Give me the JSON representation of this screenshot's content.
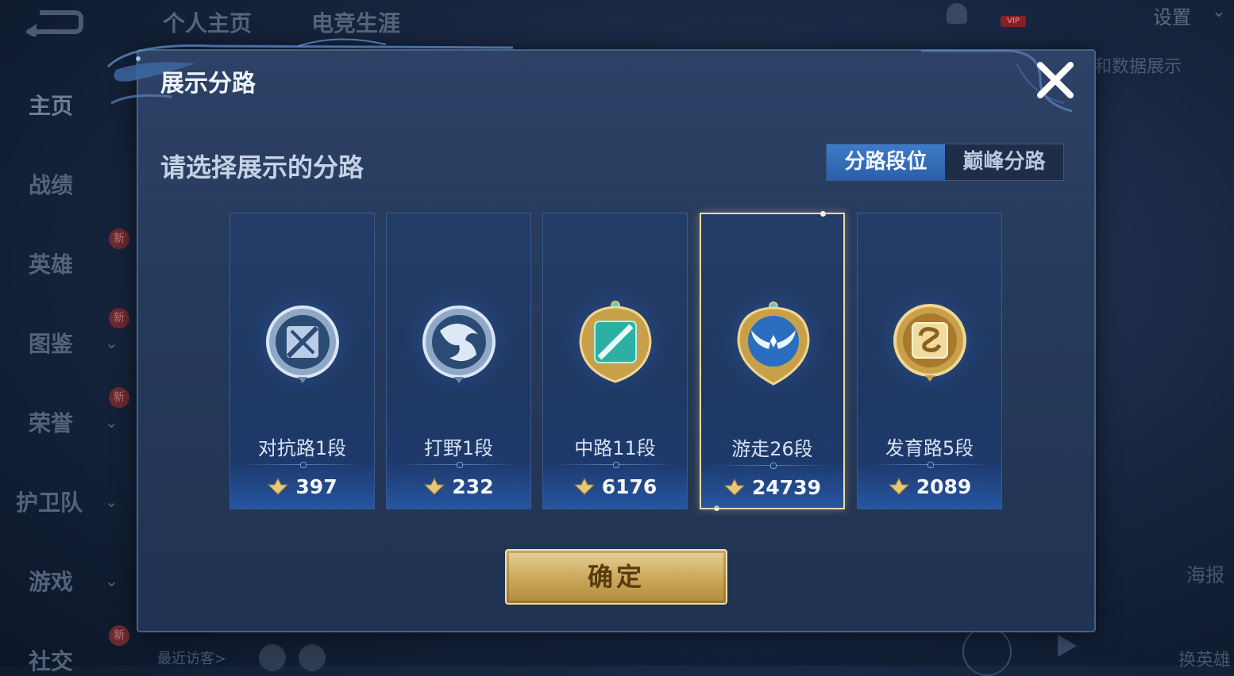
{
  "background": {
    "top_tabs": [
      "个人主页",
      "电竞生涯"
    ],
    "settings_label": "设置",
    "vip_label": "VIP",
    "right_caption": "和数据展示",
    "nav_items": [
      "主页",
      "战绩",
      "英雄",
      "图鉴",
      "荣誉",
      "护卫队",
      "游戏",
      "社交"
    ],
    "new_badge": "新",
    "recent_visitors": "最近访客>",
    "poster_label": "海报",
    "swap_label": "换英雄"
  },
  "dialog": {
    "title": "展示分路",
    "prompt": "请选择展示的分路",
    "tabs": [
      {
        "label": "分路段位",
        "active": true
      },
      {
        "label": "巅峰分路",
        "active": false
      }
    ],
    "lanes": [
      {
        "name": "对抗路1段",
        "score": "397",
        "emblem": "sword-shield-emblem",
        "selected": false
      },
      {
        "name": "打野1段",
        "score": "232",
        "emblem": "dragon-emblem",
        "selected": false
      },
      {
        "name": "中路11段",
        "score": "6176",
        "emblem": "staff-emblem",
        "selected": false
      },
      {
        "name": "游走26段",
        "score": "24739",
        "emblem": "wings-emblem",
        "selected": true
      },
      {
        "name": "发育路5段",
        "score": "2089",
        "emblem": "bow-emblem",
        "selected": false
      }
    ],
    "confirm_label": "确定"
  },
  "colors": {
    "accent_blue": "#3e7bc8",
    "gold": "#c9a659",
    "selected_border": "#e9d9a4"
  }
}
